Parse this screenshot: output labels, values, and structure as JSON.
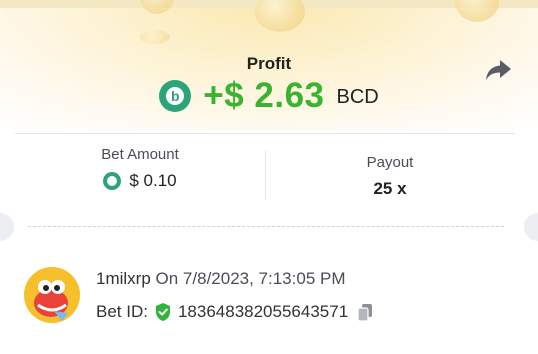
{
  "header": {
    "profit_label": "Profit",
    "profit_value": "+$ 2.63",
    "currency": "BCD",
    "accent_color": "#3ab32f",
    "coin_color": "#2ca47a"
  },
  "stats": {
    "bet_amount_label": "Bet Amount",
    "bet_amount_value": "$ 0.10",
    "payout_label": "Payout",
    "payout_value": "25 x"
  },
  "bet": {
    "username": "1milxrp",
    "date_text": "On 7/8/2023, 7:13:05 PM",
    "bet_id_label": "Bet ID:",
    "bet_id_value": "183648382055643571"
  },
  "icons": {
    "share": "share-arrow-icon",
    "verified": "shield-check-icon",
    "copy": "copy-icon",
    "currency": "bcd-coin-icon"
  }
}
